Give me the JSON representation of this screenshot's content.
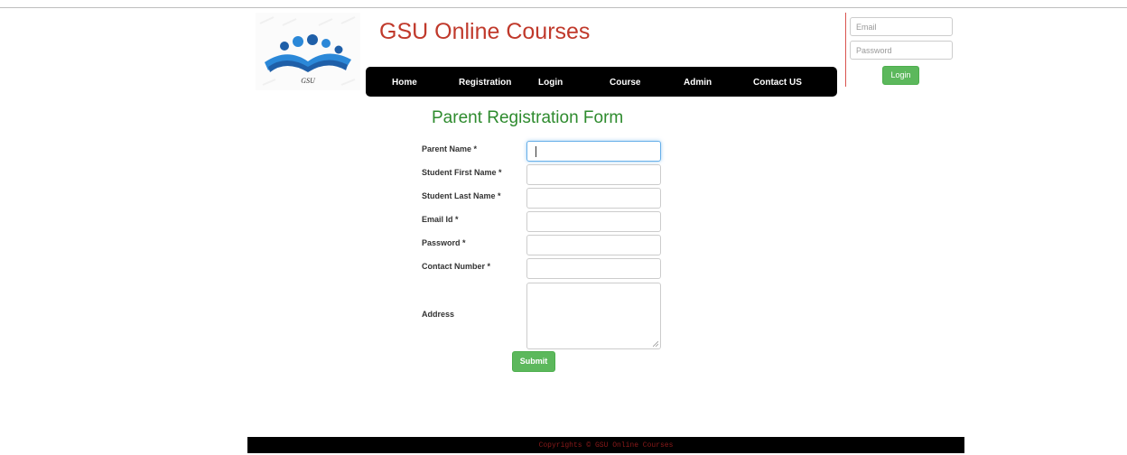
{
  "header": {
    "logo_text": "GSU",
    "site_title": "GSU Online Courses"
  },
  "nav": {
    "items": [
      {
        "label": "Home"
      },
      {
        "label": "Registration"
      },
      {
        "label": "Login"
      },
      {
        "label": "Course"
      },
      {
        "label": "Admin"
      },
      {
        "label": "Contact US"
      }
    ]
  },
  "login": {
    "email_placeholder": "Email",
    "password_placeholder": "Password",
    "button_label": "Login"
  },
  "form": {
    "title": "Parent Registration Form",
    "fields": [
      {
        "label": "Parent Name *",
        "value": ""
      },
      {
        "label": "Student First Name *",
        "value": ""
      },
      {
        "label": "Student Last Name *",
        "value": ""
      },
      {
        "label": "Email Id *",
        "value": ""
      },
      {
        "label": "Password *",
        "value": ""
      },
      {
        "label": "Contact Number *",
        "value": ""
      },
      {
        "label": "Address",
        "value": ""
      }
    ],
    "submit_label": "Submit"
  },
  "footer": {
    "text": "Copyrights © GSU Online Courses"
  },
  "colors": {
    "title_red": "#c0392b",
    "form_title_green": "#2e8b2e",
    "button_green": "#5cb85c",
    "nav_bg": "#000000",
    "footer_text": "#8b1a1a"
  }
}
